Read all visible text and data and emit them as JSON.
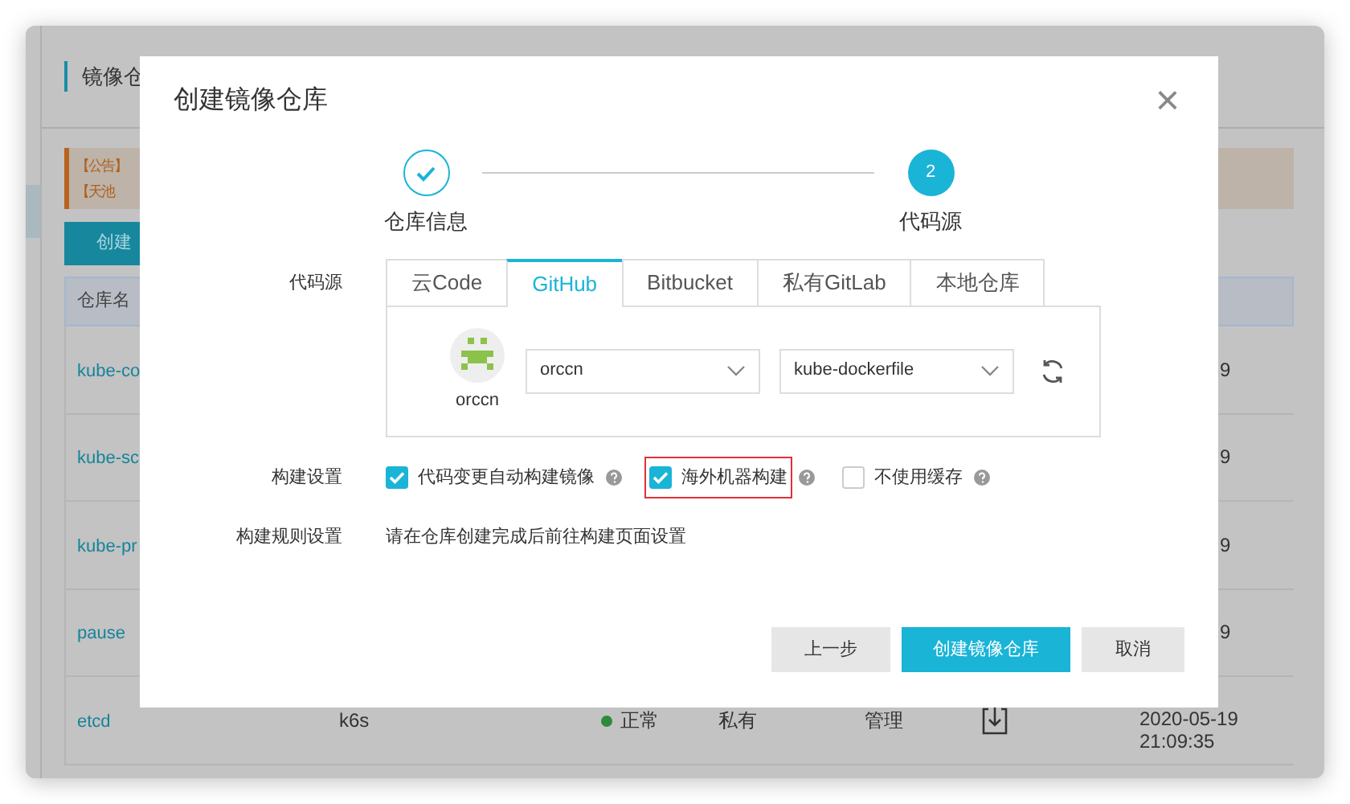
{
  "background": {
    "page_title": "镜像仓",
    "notices": [
      "【公告】",
      "【天池"
    ],
    "create_button": "创建",
    "table": {
      "column_1": "仓库名",
      "rows": [
        {
          "name": "kube-co",
          "date_tail": "9"
        },
        {
          "name": "kube-sc",
          "date_tail": "9"
        },
        {
          "name": "kube-pr",
          "date_tail": "9"
        },
        {
          "name": "pause",
          "date_tail": "9"
        },
        {
          "name": "etcd",
          "namespace": "k6s",
          "status": "正常",
          "type": "私有",
          "action": "管理",
          "date": "2020-05-19",
          "time": "21:09:35"
        }
      ]
    }
  },
  "dialog": {
    "title": "创建镜像仓库",
    "close": "×",
    "steps": [
      {
        "label": "仓库信息",
        "done": true
      },
      {
        "label": "代码源",
        "number": "2",
        "done": false
      }
    ],
    "source_label": "代码源",
    "tabs": [
      {
        "label": "云Code",
        "selected": false
      },
      {
        "label": "GitHub",
        "selected": true
      },
      {
        "label": "Bitbucket",
        "selected": false
      },
      {
        "label": "私有GitLab",
        "selected": false
      },
      {
        "label": "本地仓库",
        "selected": false
      }
    ],
    "account": {
      "name": "orccn"
    },
    "selects": [
      {
        "value": "orccn"
      },
      {
        "value": "kube-dockerfile"
      }
    ],
    "build_label": "构建设置",
    "options": [
      {
        "label": "代码变更自动构建镜像",
        "checked": true,
        "highlighted": false
      },
      {
        "label": "海外机器构建",
        "checked": true,
        "highlighted": true
      },
      {
        "label": "不使用缓存",
        "checked": false,
        "highlighted": false
      }
    ],
    "rules_label": "构建规则设置",
    "rules_text": "请在仓库创建完成后前往构建页面设置",
    "buttons": [
      {
        "label": "上一步",
        "kind": "secondary"
      },
      {
        "label": "创建镜像仓库",
        "kind": "primary"
      },
      {
        "label": "取消",
        "kind": "secondary"
      }
    ]
  }
}
